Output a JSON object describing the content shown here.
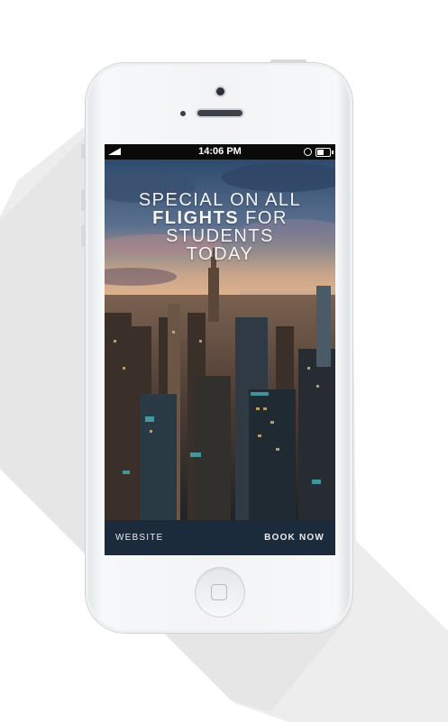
{
  "status_bar": {
    "time": "14:06 PM"
  },
  "hero": {
    "headline_line1": "SPECIAL ON ALL",
    "headline_bold": "FLIGHTS",
    "headline_line2_rest": " FOR",
    "headline_line3": "STUDENTS",
    "headline_line4": "TODAY"
  },
  "bottom_bar": {
    "website_label": "WEBSITE",
    "book_label": "BOOK NOW"
  },
  "colors": {
    "bar_bg": "#1b2b3c",
    "status_bg": "#0a0a0a",
    "phone_body": "#f3f4f5"
  },
  "icons": [
    "signal-icon",
    "alarm-icon",
    "battery-icon",
    "home-button-icon"
  ]
}
